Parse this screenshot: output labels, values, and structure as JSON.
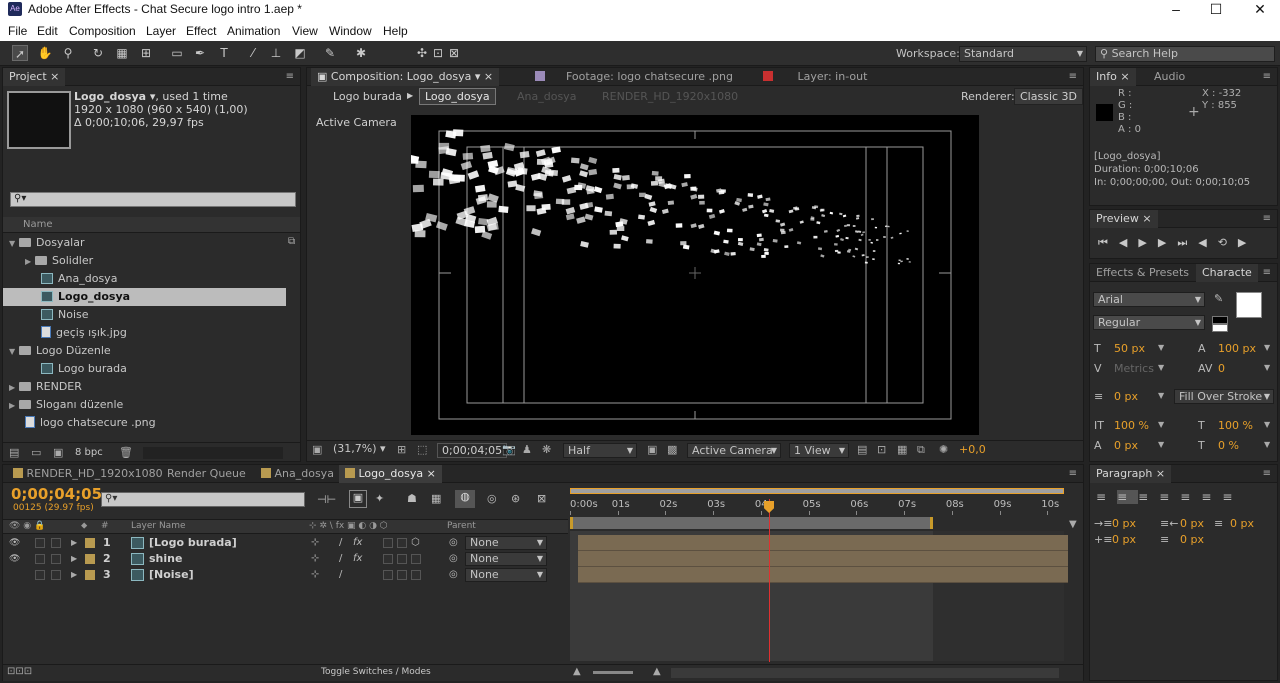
{
  "titlebar": {
    "app_badge": "Ae",
    "title": "Adobe After Effects - Chat Secure logo intro 1.aep *",
    "minimize": "–",
    "maximize": "☐",
    "close": "✕"
  },
  "menu": [
    "File",
    "Edit",
    "Composition",
    "Layer",
    "Effect",
    "Animation",
    "View",
    "Window",
    "Help"
  ],
  "toolbar": {
    "workspace_label": "Workspace:",
    "workspace_value": "Standard",
    "search_placeholder": "Search Help"
  },
  "project": {
    "tab": "Project",
    "item_name": "Logo_dosya ▾",
    "used": ", used 1 time",
    "dims": "1920 x 1080  (960 x 540) (1,00)",
    "duration": "Δ 0;00;10;06, 29,97 fps",
    "column_name": "Name",
    "bpc": "8 bpc",
    "tree": [
      {
        "label": "Dosyalar",
        "type": "folder",
        "indent": 0,
        "open": true
      },
      {
        "label": "Solidler",
        "type": "folder",
        "indent": 1,
        "open": false
      },
      {
        "label": "Ana_dosya",
        "type": "comp",
        "indent": 2
      },
      {
        "label": "Logo_dosya",
        "type": "comp",
        "indent": 2,
        "selected": true
      },
      {
        "label": "Noise",
        "type": "comp",
        "indent": 2
      },
      {
        "label": "geçiş ışık.jpg",
        "type": "image",
        "indent": 2
      },
      {
        "label": "Logo Düzenle",
        "type": "folder",
        "indent": 0,
        "open": true
      },
      {
        "label": "Logo burada",
        "type": "comp",
        "indent": 2
      },
      {
        "label": "RENDER",
        "type": "folder",
        "indent": 0,
        "open": false
      },
      {
        "label": "Sloganı düzenle",
        "type": "folder",
        "indent": 0,
        "open": false
      },
      {
        "label": "logo chatsecure .png",
        "type": "image",
        "indent": 1
      }
    ]
  },
  "viewer": {
    "tabs": [
      "Composition: Logo_dosya",
      "Footage: logo chatsecure .png",
      "Layer: in-out"
    ],
    "breadcrumbs": [
      "Logo burada",
      "Logo_dosya",
      "Ana_dosya",
      "RENDER_HD_1920x1080"
    ],
    "renderer_label": "Renderer:",
    "renderer_value": "Classic 3D",
    "camera_label": "Active Camera",
    "zoom": "(31,7%)",
    "timecode": "0;00;04;05",
    "resolution": "Half",
    "camera": "Active Camera",
    "views": "1 View",
    "exposure": "+0,0"
  },
  "info": {
    "tabs": [
      "Info",
      "Audio"
    ],
    "r": "R :",
    "g": "G :",
    "b": "B :",
    "a": "A : 0",
    "x": "X : -332",
    "y": "Y : 855",
    "name": "[Logo_dosya]",
    "duration": "Duration: 0;00;10;06",
    "inout": "In: 0;00;00;00, Out: 0;00;10;05"
  },
  "preview": {
    "tab": "Preview"
  },
  "character": {
    "tabs": [
      "Effects & Presets",
      "Characte"
    ],
    "font": "Arial",
    "style": "Regular",
    "size": "50 px",
    "leading": "100 px",
    "kerning": "Metrics",
    "tracking": "0",
    "stroke": "0 px",
    "stroke_mode": "Fill Over Stroke",
    "vscale": "100 %",
    "hscale": "100 %",
    "baseline": "0 px",
    "tsume": "0 %"
  },
  "paragraph": {
    "tab": "Paragraph",
    "indent_left": "0 px",
    "indent_right": "0 px",
    "first": "0 px",
    "space_before": "0 px",
    "space_after": "0 px"
  },
  "timeline": {
    "tabs": [
      "RENDER_HD_1920x1080",
      "Render Queue",
      "Ana_dosya",
      "Logo_dosya"
    ],
    "timecode": "0;00;04;05",
    "frames": "00125 (29.97 fps)",
    "col_layer": "Layer Name",
    "col_num": "#",
    "col_parent": "Parent",
    "ruler": [
      "0:00s",
      "01s",
      "02s",
      "03s",
      "04s",
      "05s",
      "06s",
      "07s",
      "08s",
      "09s",
      "10s"
    ],
    "playhead_seconds": 4.17,
    "work_area_end_seconds": 7.6,
    "layers": [
      {
        "num": "1",
        "name": "[Logo burada]",
        "parent": "None"
      },
      {
        "num": "2",
        "name": "shine",
        "parent": "None"
      },
      {
        "num": "3",
        "name": "[Noise]",
        "parent": "None"
      }
    ],
    "toggle_label": "Toggle Switches / Modes"
  },
  "colors": {
    "accent": "#e8a02a",
    "playhead": "#e03030",
    "layer_bar": "#7a6a52"
  }
}
